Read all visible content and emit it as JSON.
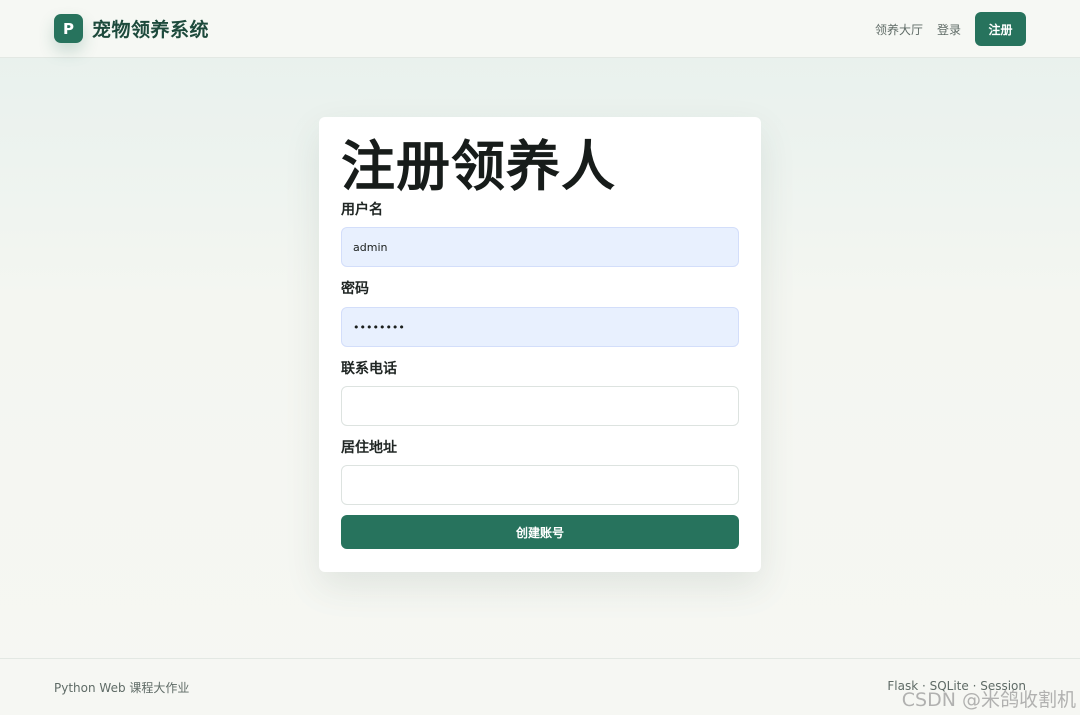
{
  "header": {
    "logo_letter": "P",
    "brand_name": "宠物领养系统",
    "nav": {
      "hall": "领养大厅",
      "login": "登录",
      "register": "注册"
    }
  },
  "form": {
    "title": "注册领养人",
    "username": {
      "label": "用户名",
      "value": "admin"
    },
    "password": {
      "label": "密码",
      "value": "password"
    },
    "phone": {
      "label": "联系电话",
      "value": ""
    },
    "address": {
      "label": "居住地址",
      "value": ""
    },
    "submit_label": "创建账号"
  },
  "footer": {
    "left": "Python Web 课程大作业",
    "right": "Flask · SQLite · Session"
  },
  "watermark": "CSDN @米鸽收割机",
  "colors": {
    "primary": "#27735d",
    "autofill": "#e8f0fe",
    "background": "#f6f7f3"
  }
}
